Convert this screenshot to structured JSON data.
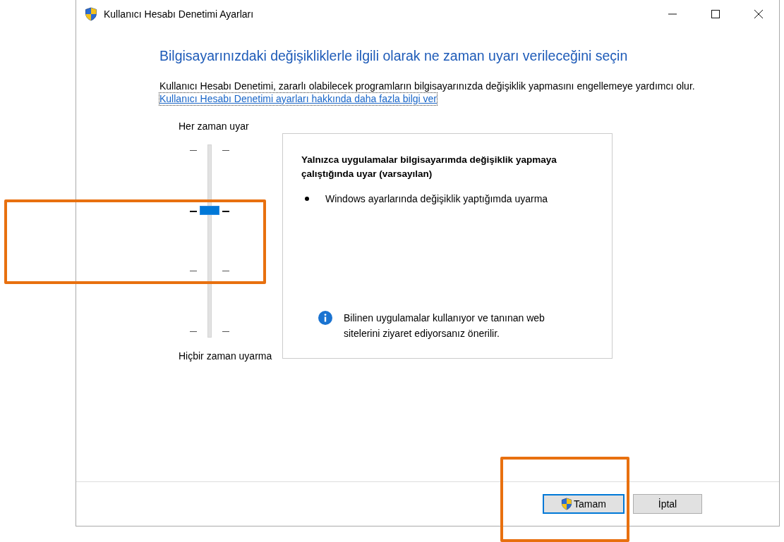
{
  "window": {
    "title": "Kullanıcı Hesabı Denetimi Ayarları"
  },
  "heading": "Bilgisayarınızdaki değişikliklerle ilgili olarak ne zaman uyarı verileceğini seçin",
  "description": "Kullanıcı Hesabı Denetimi, zararlı olabilecek programların bilgisayarınızda değişiklik yapmasını engellemeye yardımcı olur.",
  "link": "Kullanıcı Hesabı Denetimi ayarları hakkında daha fazla bilgi ver",
  "slider": {
    "top_label": "Her zaman uyar",
    "bottom_label": "Hiçbir zaman uyarma",
    "level": 0.67
  },
  "details": {
    "title": "Yalnızca uygulamalar bilgisayarımda değişiklik yapmaya çalıştığında uyar (varsayılan)",
    "bullets": [
      "Windows ayarlarında değişiklik yaptığımda uyarma"
    ],
    "note": "Bilinen uygulamalar kullanıyor ve tanınan web sitelerini ziyaret ediyorsanız önerilir."
  },
  "buttons": [
    {
      "label": "Tamam",
      "kind": "shield",
      "default": true
    },
    {
      "label": "İptal",
      "kind": "plain",
      "default": false
    }
  ]
}
